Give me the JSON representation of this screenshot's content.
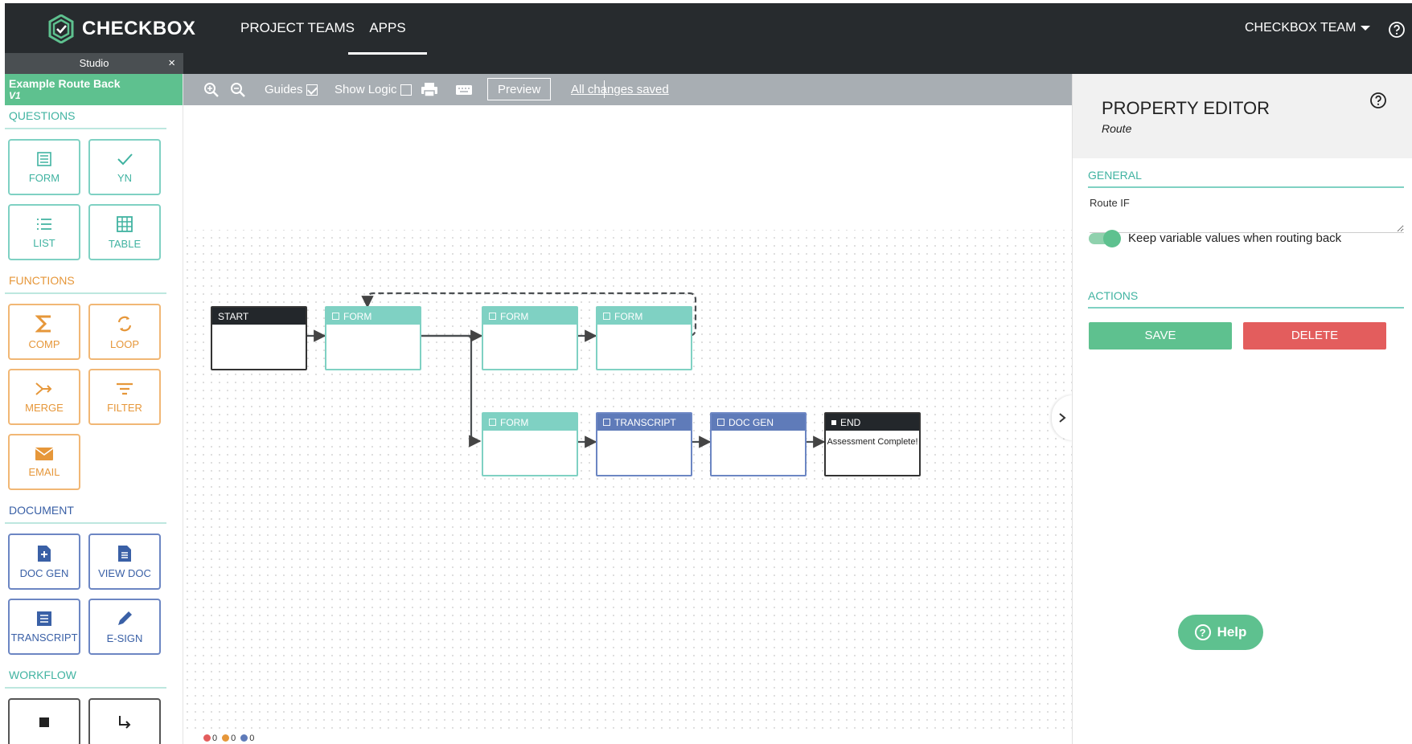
{
  "brand": {
    "name": "CHECKBOX"
  },
  "nav": {
    "tabs": [
      "PROJECT TEAMS",
      "APPS"
    ],
    "active_tab": "APPS",
    "team_menu": "CHECKBOX TEAM"
  },
  "studio": {
    "tab_label": "Studio",
    "close_symbol": "×",
    "app_name": "Example Route Back",
    "version": "V1"
  },
  "palette": {
    "questions": {
      "title": "QUESTIONS",
      "items": [
        {
          "label": "FORM",
          "icon": "form-icon"
        },
        {
          "label": "YN",
          "icon": "check-icon"
        },
        {
          "label": "LIST",
          "icon": "list-icon"
        },
        {
          "label": "TABLE",
          "icon": "table-icon"
        }
      ]
    },
    "functions": {
      "title": "FUNCTIONS",
      "items": [
        {
          "label": "COMP",
          "icon": "sigma-icon"
        },
        {
          "label": "LOOP",
          "icon": "loop-icon"
        },
        {
          "label": "MERGE",
          "icon": "merge-icon"
        },
        {
          "label": "FILTER",
          "icon": "filter-icon"
        },
        {
          "label": "EMAIL",
          "icon": "envelope-icon"
        }
      ]
    },
    "document": {
      "title": "DOCUMENT",
      "items": [
        {
          "label": "DOC GEN",
          "icon": "doc-add-icon"
        },
        {
          "label": "VIEW DOC",
          "icon": "doc-view-icon"
        },
        {
          "label": "TRANSCRIPT",
          "icon": "transcript-icon"
        },
        {
          "label": "E-SIGN",
          "icon": "pen-icon"
        }
      ]
    },
    "workflow": {
      "title": "WORKFLOW",
      "items": [
        {
          "icon": "stop-square-icon"
        },
        {
          "icon": "route-arrow-icon"
        }
      ]
    }
  },
  "toolbar": {
    "guides_label": "Guides",
    "guides_checked": true,
    "show_logic_label": "Show Logic",
    "show_logic_checked": false,
    "preview_label": "Preview",
    "saved_status": "All changes saved"
  },
  "status": {
    "errors": "0",
    "warnings": "0",
    "info": "0"
  },
  "flow": {
    "nodes": [
      {
        "id": "start",
        "title": "START",
        "kind": "start"
      },
      {
        "id": "form1",
        "title": "FORM",
        "kind": "form"
      },
      {
        "id": "form2",
        "title": "FORM",
        "kind": "form"
      },
      {
        "id": "form3",
        "title": "FORM",
        "kind": "form"
      },
      {
        "id": "form4",
        "title": "FORM",
        "kind": "form"
      },
      {
        "id": "transcript",
        "title": "TRANSCRIPT",
        "kind": "doc"
      },
      {
        "id": "docgen",
        "title": "DOC GEN",
        "kind": "doc"
      },
      {
        "id": "end",
        "title": "END",
        "kind": "end",
        "body": "Assessment Complete!"
      }
    ]
  },
  "property_editor": {
    "title": "PROPERTY EDITOR",
    "subtitle": "Route",
    "general_title": "GENERAL",
    "route_if_label": "Route IF",
    "route_if_value": "",
    "keep_values_label": "Keep variable values when routing back",
    "keep_values_on": true,
    "actions_title": "ACTIONS",
    "save_label": "SAVE",
    "delete_label": "DELETE"
  },
  "help": {
    "label": "Help"
  },
  "colors": {
    "accent_green": "#5ec18f",
    "question_teal": "#7fd1c3",
    "function_orange": "#f1b775",
    "document_blue": "#6c86c3",
    "danger_red": "#e35d5d",
    "nav_dark": "#272b2e"
  }
}
